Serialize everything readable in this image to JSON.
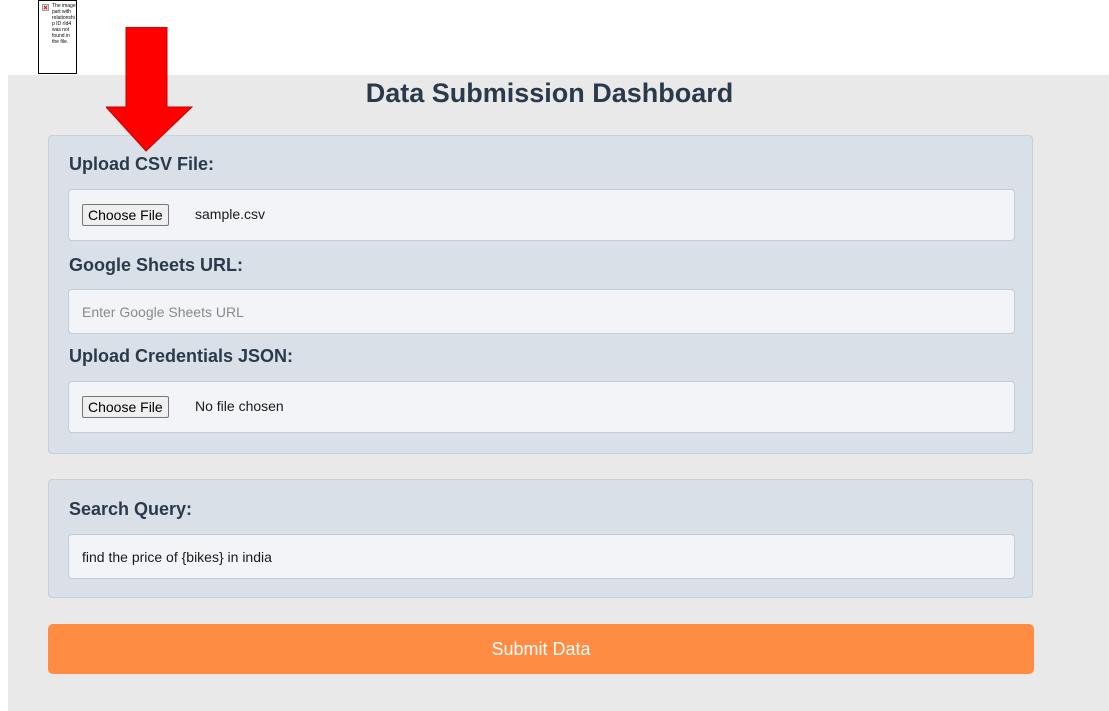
{
  "broken_image": {
    "message": "The image part with relationship ID rId4 was not found in the file."
  },
  "page": {
    "title": "Data Submission Dashboard"
  },
  "upload_csv": {
    "label": "Upload CSV File:",
    "button_label": "Choose File",
    "file_name": "sample.csv"
  },
  "google_sheets": {
    "label": "Google Sheets URL:",
    "value": "",
    "placeholder": "Enter Google Sheets URL"
  },
  "credentials": {
    "label": "Upload Credentials JSON:",
    "button_label": "Choose File",
    "file_name": "No file chosen"
  },
  "search": {
    "label": "Search Query:",
    "value": "find the price of {bikes} in india",
    "placeholder": ""
  },
  "submit": {
    "label": "Submit Data"
  },
  "icons": {
    "broken_image": "broken-image-icon",
    "annotation": "red-arrow-down-icon"
  },
  "colors": {
    "accent": "#ff8c42",
    "panel": "#d9e0e8",
    "page_background": "#e9e9e9",
    "heading_text": "#2b3a4a",
    "arrow": "#ff0000"
  }
}
